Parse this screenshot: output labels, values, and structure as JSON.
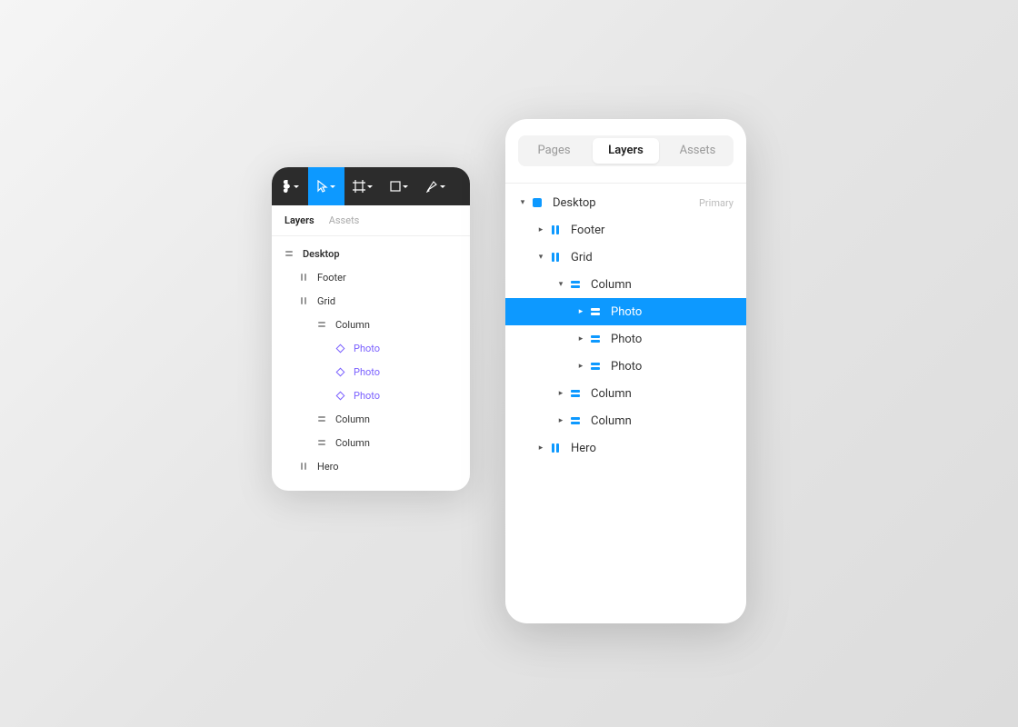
{
  "small": {
    "tabs": {
      "layers": "Layers",
      "assets": "Assets"
    },
    "rows": {
      "desktop": "Desktop",
      "footer": "Footer",
      "grid": "Grid",
      "column": "Column",
      "photo": "Photo",
      "hero": "Hero"
    }
  },
  "big": {
    "seg": {
      "pages": "Pages",
      "layers": "Layers",
      "assets": "Assets"
    },
    "badge_primary": "Primary",
    "rows": {
      "desktop": "Desktop",
      "footer": "Footer",
      "grid": "Grid",
      "column": "Column",
      "photo": "Photo",
      "hero": "Hero"
    }
  }
}
